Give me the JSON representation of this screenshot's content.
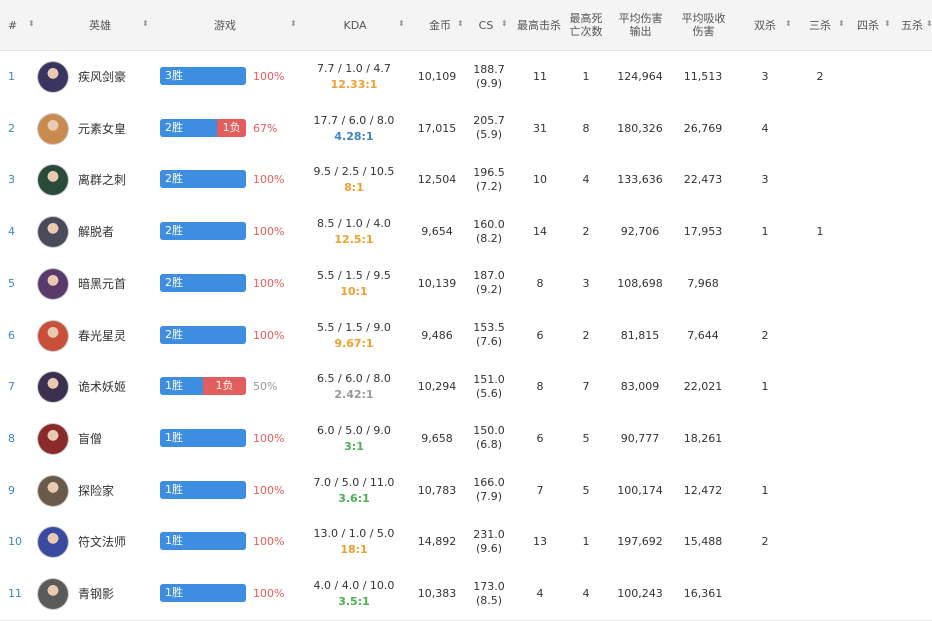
{
  "header": {
    "rank": "#",
    "hero": "英雄",
    "games": "游戏",
    "kda": "KDA",
    "gold": "金币",
    "cs": "CS",
    "max_kills": "最高击杀",
    "max_deaths_l1": "最高死",
    "max_deaths_l2": "亡次数",
    "avg_dmg_l1": "平均伤害",
    "avg_dmg_l2": "输出",
    "avg_taken_l1": "平均吸收",
    "avg_taken_l2": "伤害",
    "double": "双杀",
    "triple": "三杀",
    "quadra": "四杀",
    "penta": "五杀",
    "sort_glyph": "⬍"
  },
  "colors": {
    "win": "#3d8de0",
    "loss": "#e25d5d",
    "pct_good": "#e25d5d",
    "pct_mid": "#999999",
    "kda_orange": "#f0a030",
    "kda_blue": "#3b86c8",
    "kda_green": "#4caf50",
    "kda_gray": "#999999"
  },
  "rows": [
    {
      "rank": "1",
      "hero": "疾风剑豪",
      "wins": 3,
      "losses": 0,
      "win_label": "3胜",
      "loss_label": "",
      "pct": "100%",
      "pct_color": "#e25d5d",
      "kda_line": "7.7 / 1.0 / 4.7",
      "kda_ratio": "12.33:1",
      "kda_color": "#f0a030",
      "gold": "10,109",
      "cs": "188.7",
      "cs_sub": "(9.9)",
      "max_kills": "11",
      "max_deaths": "1",
      "avg_dmg": "124,964",
      "avg_taken": "11,513",
      "double": "3",
      "triple": "2",
      "quadra": "",
      "penta": "",
      "avatar": "#3a3560"
    },
    {
      "rank": "2",
      "hero": "元素女皇",
      "wins": 2,
      "losses": 1,
      "win_label": "2胜",
      "loss_label": "1负",
      "pct": "67%",
      "pct_color": "#e25d5d",
      "kda_line": "17.7 / 6.0 / 8.0",
      "kda_ratio": "4.28:1",
      "kda_color": "#3b86c8",
      "gold": "17,015",
      "cs": "205.7",
      "cs_sub": "(5.9)",
      "max_kills": "31",
      "max_deaths": "8",
      "avg_dmg": "180,326",
      "avg_taken": "26,769",
      "double": "4",
      "triple": "",
      "quadra": "",
      "penta": "",
      "avatar": "#c98a50"
    },
    {
      "rank": "3",
      "hero": "离群之刺",
      "wins": 2,
      "losses": 0,
      "win_label": "2胜",
      "loss_label": "",
      "pct": "100%",
      "pct_color": "#e25d5d",
      "kda_line": "9.5 / 2.5 / 10.5",
      "kda_ratio": "8:1",
      "kda_color": "#f0a030",
      "gold": "12,504",
      "cs": "196.5",
      "cs_sub": "(7.2)",
      "max_kills": "10",
      "max_deaths": "4",
      "avg_dmg": "133,636",
      "avg_taken": "22,473",
      "double": "3",
      "triple": "",
      "quadra": "",
      "penta": "",
      "avatar": "#2a4a3a"
    },
    {
      "rank": "4",
      "hero": "解脱者",
      "wins": 2,
      "losses": 0,
      "win_label": "2胜",
      "loss_label": "",
      "pct": "100%",
      "pct_color": "#e25d5d",
      "kda_line": "8.5 / 1.0 / 4.0",
      "kda_ratio": "12.5:1",
      "kda_color": "#f0a030",
      "gold": "9,654",
      "cs": "160.0",
      "cs_sub": "(8.2)",
      "max_kills": "14",
      "max_deaths": "2",
      "avg_dmg": "92,706",
      "avg_taken": "17,953",
      "double": "1",
      "triple": "1",
      "quadra": "",
      "penta": "",
      "avatar": "#4a4a5a"
    },
    {
      "rank": "5",
      "hero": "暗黑元首",
      "wins": 2,
      "losses": 0,
      "win_label": "2胜",
      "loss_label": "",
      "pct": "100%",
      "pct_color": "#e25d5d",
      "kda_line": "5.5 / 1.5 / 9.5",
      "kda_ratio": "10:1",
      "kda_color": "#f0a030",
      "gold": "10,139",
      "cs": "187.0",
      "cs_sub": "(9.2)",
      "max_kills": "8",
      "max_deaths": "3",
      "avg_dmg": "108,698",
      "avg_taken": "7,968",
      "double": "",
      "triple": "",
      "quadra": "",
      "penta": "",
      "avatar": "#5a3a6a"
    },
    {
      "rank": "6",
      "hero": "春光星灵",
      "wins": 2,
      "losses": 0,
      "win_label": "2胜",
      "loss_label": "",
      "pct": "100%",
      "pct_color": "#e25d5d",
      "kda_line": "5.5 / 1.5 / 9.0",
      "kda_ratio": "9.67:1",
      "kda_color": "#f0a030",
      "gold": "9,486",
      "cs": "153.5",
      "cs_sub": "(7.6)",
      "max_kills": "6",
      "max_deaths": "2",
      "avg_dmg": "81,815",
      "avg_taken": "7,644",
      "double": "2",
      "triple": "",
      "quadra": "",
      "penta": "",
      "avatar": "#c8503a"
    },
    {
      "rank": "7",
      "hero": "诡术妖姬",
      "wins": 1,
      "losses": 1,
      "win_label": "1胜",
      "loss_label": "1负",
      "pct": "50%",
      "pct_color": "#999999",
      "kda_line": "6.5 / 6.0 / 8.0",
      "kda_ratio": "2.42:1",
      "kda_color": "#999999",
      "gold": "10,294",
      "cs": "151.0",
      "cs_sub": "(5.6)",
      "max_kills": "8",
      "max_deaths": "7",
      "avg_dmg": "83,009",
      "avg_taken": "22,021",
      "double": "1",
      "triple": "",
      "quadra": "",
      "penta": "",
      "avatar": "#3a3050"
    },
    {
      "rank": "8",
      "hero": "盲僧",
      "wins": 1,
      "losses": 0,
      "win_label": "1胜",
      "loss_label": "",
      "pct": "100%",
      "pct_color": "#e25d5d",
      "kda_line": "6.0 / 5.0 / 9.0",
      "kda_ratio": "3:1",
      "kda_color": "#4caf50",
      "gold": "9,658",
      "cs": "150.0",
      "cs_sub": "(6.8)",
      "max_kills": "6",
      "max_deaths": "5",
      "avg_dmg": "90,777",
      "avg_taken": "18,261",
      "double": "",
      "triple": "",
      "quadra": "",
      "penta": "",
      "avatar": "#8a2a2a"
    },
    {
      "rank": "9",
      "hero": "探险家",
      "wins": 1,
      "losses": 0,
      "win_label": "1胜",
      "loss_label": "",
      "pct": "100%",
      "pct_color": "#e25d5d",
      "kda_line": "7.0 / 5.0 / 11.0",
      "kda_ratio": "3.6:1",
      "kda_color": "#4caf50",
      "gold": "10,783",
      "cs": "166.0",
      "cs_sub": "(7.9)",
      "max_kills": "7",
      "max_deaths": "5",
      "avg_dmg": "100,174",
      "avg_taken": "12,472",
      "double": "1",
      "triple": "",
      "quadra": "",
      "penta": "",
      "avatar": "#6a5a4a"
    },
    {
      "rank": "10",
      "hero": "符文法师",
      "wins": 1,
      "losses": 0,
      "win_label": "1胜",
      "loss_label": "",
      "pct": "100%",
      "pct_color": "#e25d5d",
      "kda_line": "13.0 / 1.0 / 5.0",
      "kda_ratio": "18:1",
      "kda_color": "#f0a030",
      "gold": "14,892",
      "cs": "231.0",
      "cs_sub": "(9.6)",
      "max_kills": "13",
      "max_deaths": "1",
      "avg_dmg": "197,692",
      "avg_taken": "15,488",
      "double": "2",
      "triple": "",
      "quadra": "",
      "penta": "",
      "avatar": "#3a4aa0"
    },
    {
      "rank": "11",
      "hero": "青钢影",
      "wins": 1,
      "losses": 0,
      "win_label": "1胜",
      "loss_label": "",
      "pct": "100%",
      "pct_color": "#e25d5d",
      "kda_line": "4.0 / 4.0 / 10.0",
      "kda_ratio": "3.5:1",
      "kda_color": "#4caf50",
      "gold": "10,383",
      "cs": "173.0",
      "cs_sub": "(8.5)",
      "max_kills": "4",
      "max_deaths": "4",
      "avg_dmg": "100,243",
      "avg_taken": "16,361",
      "double": "",
      "triple": "",
      "quadra": "",
      "penta": "",
      "avatar": "#5a5a5a"
    }
  ]
}
